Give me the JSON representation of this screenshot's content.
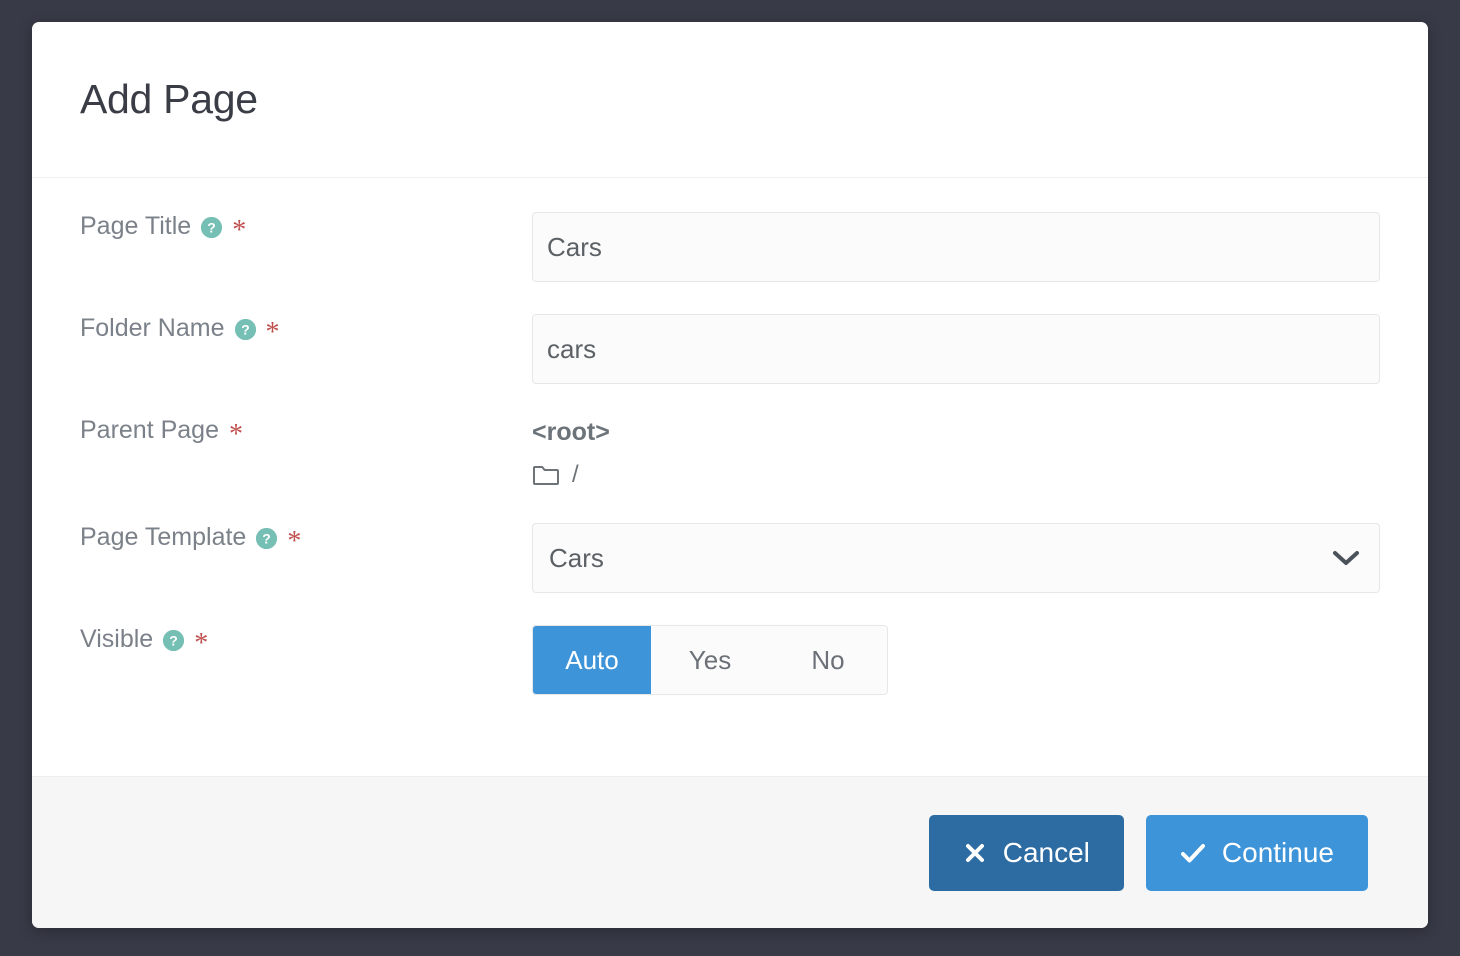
{
  "modal": {
    "title": "Add Page",
    "fields": [
      {
        "label": "Page Title",
        "has_help": true,
        "required_marker": "*",
        "control": "text",
        "value": "Cars",
        "placeholder": ""
      },
      {
        "label": "Folder Name",
        "has_help": true,
        "required_marker": "*",
        "control": "text",
        "value": "cars",
        "placeholder": ""
      },
      {
        "label": "Parent Page",
        "has_help": false,
        "required_marker": "*",
        "control": "parent-display",
        "root_label": "<root>",
        "path": "/",
        "folder_icon": "folder-icon"
      },
      {
        "label": "Page Template",
        "has_help": true,
        "required_marker": "*",
        "control": "select",
        "value": "Cars",
        "chevron_icon": "chevron-down-icon"
      },
      {
        "label": "Visible",
        "has_help": true,
        "required_marker": "*",
        "control": "segmented",
        "options": [
          "Auto",
          "Yes",
          "No"
        ],
        "selected": "Auto"
      }
    ],
    "footer": {
      "cancel_label": "Cancel",
      "cancel_icon": "times-icon",
      "continue_label": "Continue",
      "continue_icon": "check-icon"
    }
  },
  "help_icon_glyph": "?",
  "colors": {
    "backdrop": "#383a47",
    "modal_bg": "#ffffff",
    "footer_bg": "#f6f6f7",
    "accent_blue": "#3d94d9",
    "cancel_blue": "#2d6ca2",
    "help_teal": "#76bfb5",
    "required_red": "#c0504f",
    "label_gray": "#7b8189",
    "title_gray": "#3b3d46"
  }
}
